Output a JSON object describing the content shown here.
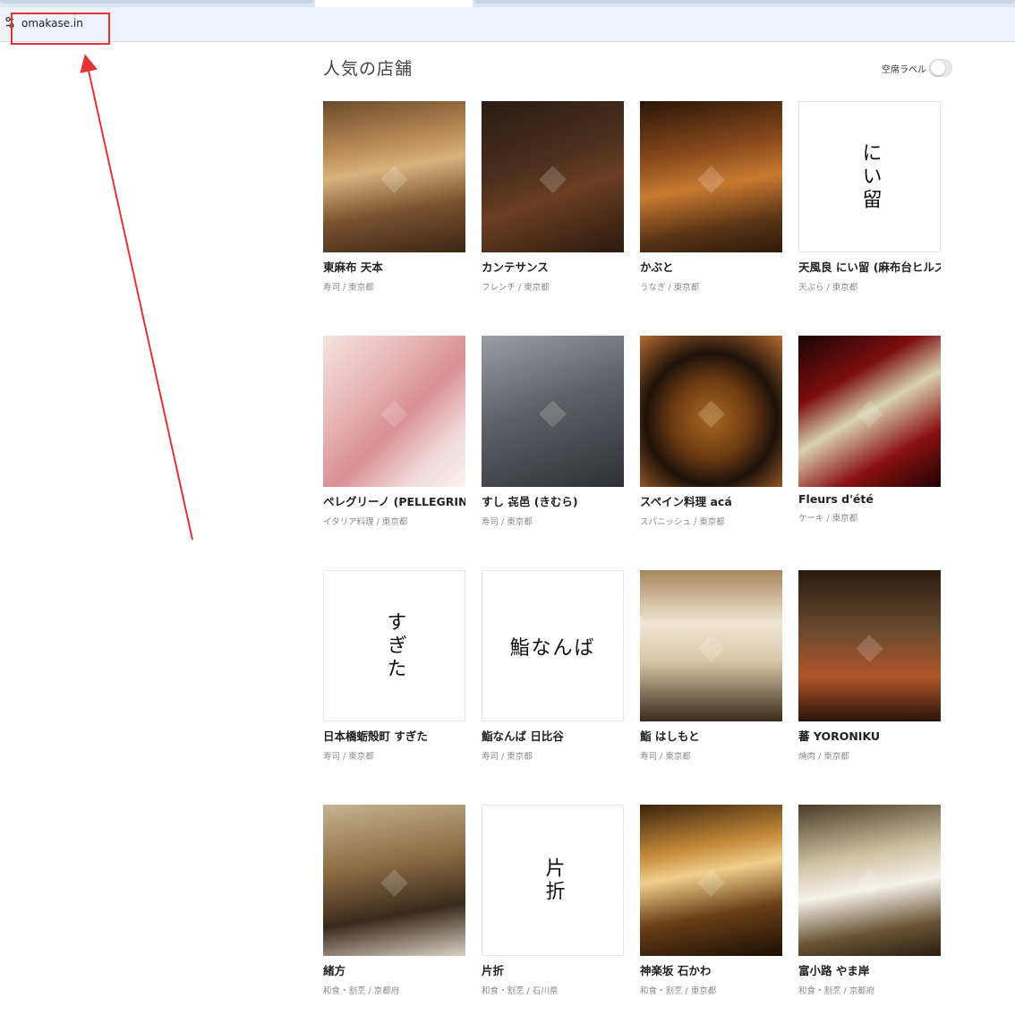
{
  "browser": {
    "url": "omakase.in",
    "site_icon": "site-settings-icon",
    "annotation_color": "#e23434"
  },
  "section": {
    "title": "人気の店舗",
    "toggle_label": "空席ラベル",
    "toggle_on": false
  },
  "restaurants": [
    {
      "name": "東麻布 天本",
      "category": "寿司 / 東京都",
      "thumb": "photo",
      "bg": "bg-tenmoto"
    },
    {
      "name": "カンテサンス",
      "category": "フレンチ / 東京都",
      "thumb": "photo",
      "bg": "bg-quintessence"
    },
    {
      "name": "かぶと",
      "category": "うなぎ / 東京都",
      "thumb": "photo",
      "bg": "bg-kabuto"
    },
    {
      "name": "天風良 にい留 (麻布台ヒルズ)",
      "category": "天ぷら / 東京都",
      "thumb": "logo",
      "logo": "にい留"
    },
    {
      "name": "ペレグリーノ (PELLEGRINO)",
      "category": "イタリア料理 / 東京都",
      "thumb": "photo",
      "bg": "bg-pellegrino"
    },
    {
      "name": "すし 㐂邑 (きむら)",
      "category": "寿司 / 東京都",
      "thumb": "photo",
      "bg": "bg-kimura"
    },
    {
      "name": "スペイン料理 acá",
      "category": "スパニッシュ / 東京都",
      "thumb": "photo",
      "bg": "bg-aca"
    },
    {
      "name": "Fleurs d'été",
      "category": "ケーキ / 東京都",
      "thumb": "photo",
      "bg": "bg-fleurs"
    },
    {
      "name": "日本橋蛎殻町 すぎた",
      "category": "寿司 / 東京都",
      "thumb": "logo",
      "logo": "すぎた"
    },
    {
      "name": "鮨なんば 日比谷",
      "category": "寿司 / 東京都",
      "thumb": "logo",
      "logo": "鮨なんば",
      "logo_horizontal": true
    },
    {
      "name": "鮨 はしもと",
      "category": "寿司 / 東京都",
      "thumb": "photo",
      "bg": "bg-hashimoto"
    },
    {
      "name": "蕃 YORONIKU",
      "category": "焼肉 / 東京都",
      "thumb": "photo",
      "bg": "bg-yoroniku"
    },
    {
      "name": "緒方",
      "category": "和食・割烹 / 京都府",
      "thumb": "photo",
      "bg": "bg-ogata"
    },
    {
      "name": "片折",
      "category": "和食・割烹 / 石川県",
      "thumb": "logo",
      "logo": "片折"
    },
    {
      "name": "神楽坂 石かわ",
      "category": "和食・割烹 / 東京都",
      "thumb": "photo",
      "bg": "bg-ishikawa"
    },
    {
      "name": "富小路 やま岸",
      "category": "和食・割烹 / 京都府",
      "thumb": "photo",
      "bg": "bg-yamagishi"
    }
  ]
}
